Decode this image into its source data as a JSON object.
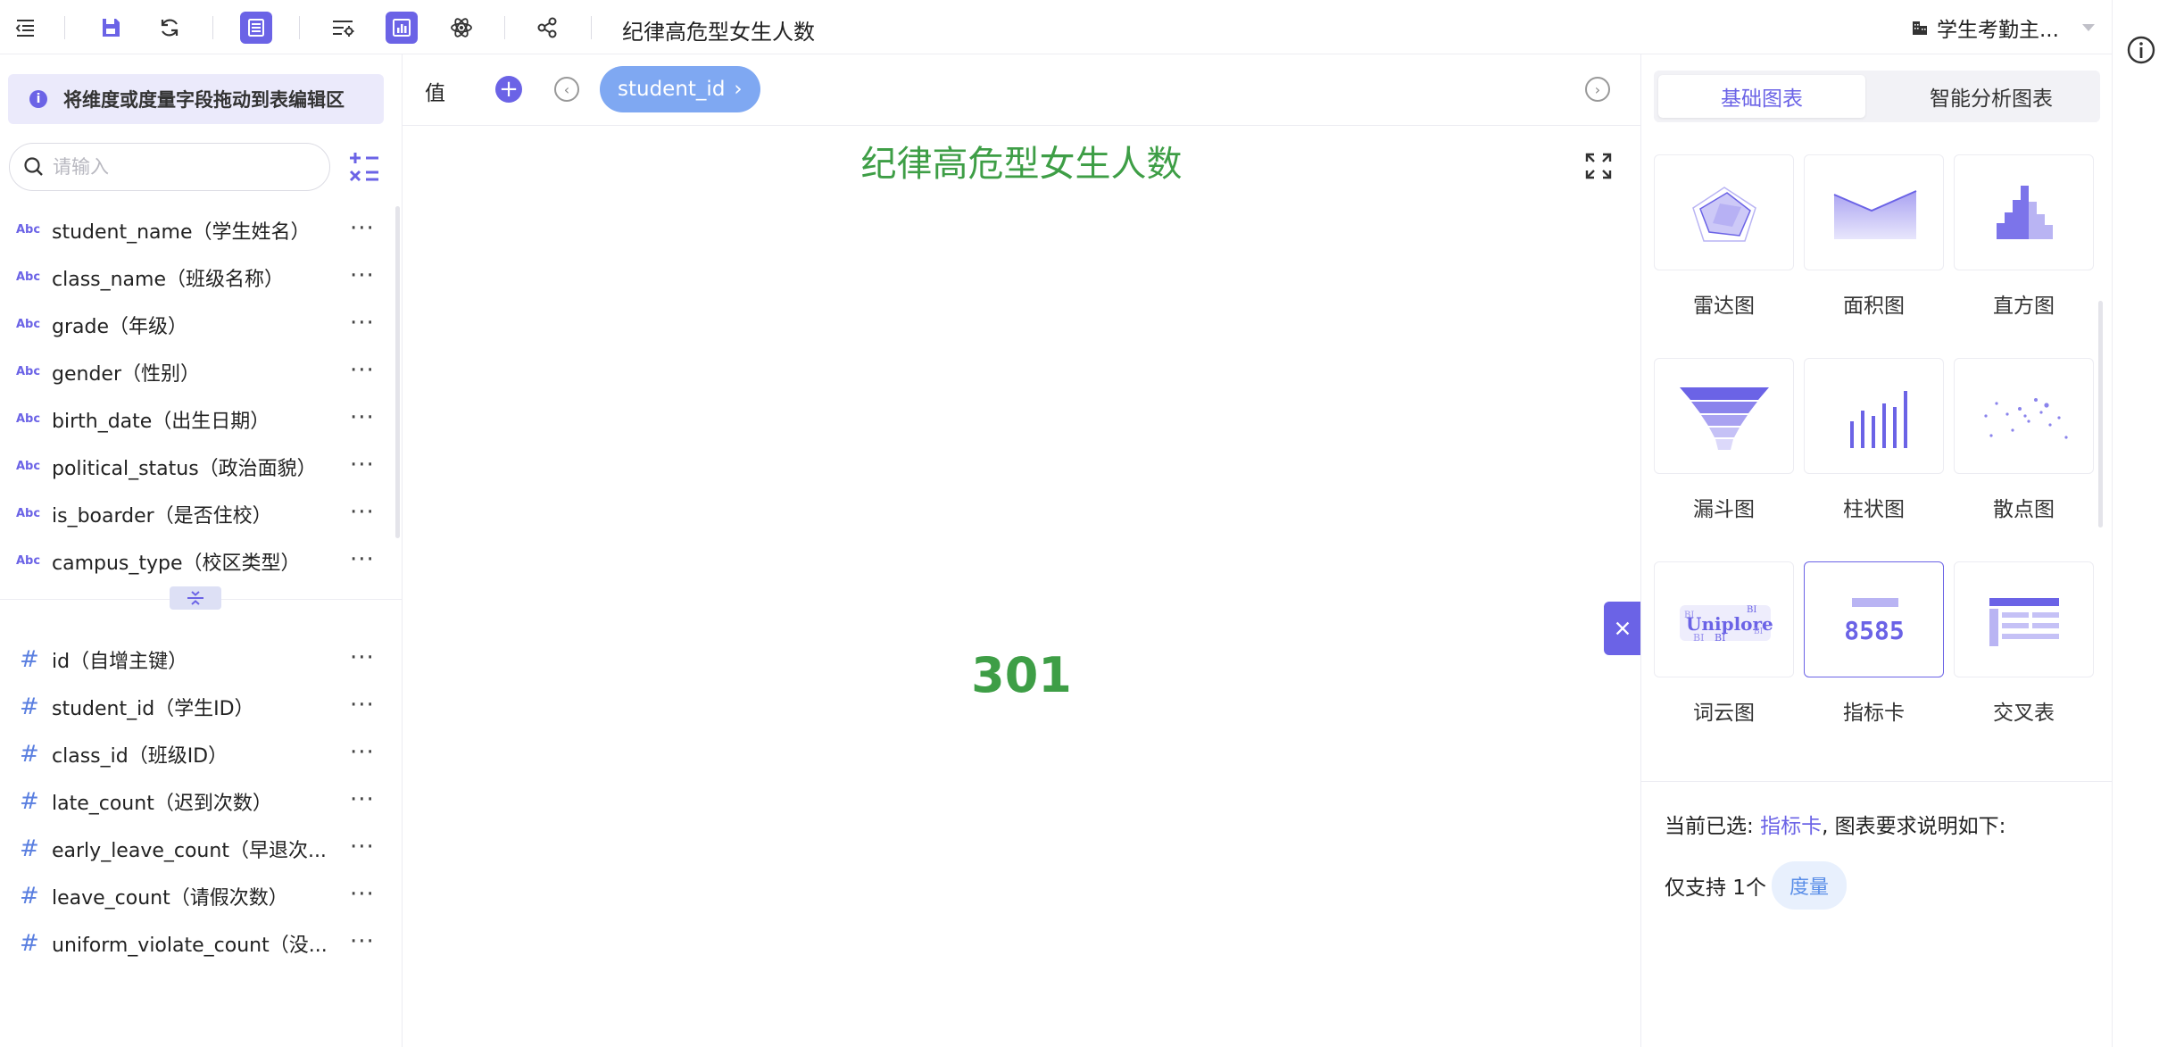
{
  "toolbar": {
    "title": "纪律高危型女生人数",
    "datasource": "学生考勤主..."
  },
  "left_panel": {
    "hint": "将维度或度量字段拖动到表编辑区",
    "search_placeholder": "请输入",
    "dimensions": [
      {
        "type": "Abc",
        "name": "student_name（学生姓名）"
      },
      {
        "type": "Abc",
        "name": "class_name（班级名称）"
      },
      {
        "type": "Abc",
        "name": "grade（年级）"
      },
      {
        "type": "Abc",
        "name": "gender（性别）"
      },
      {
        "type": "Abc",
        "name": "birth_date（出生日期）"
      },
      {
        "type": "Abc",
        "name": "political_status（政治面貌）"
      },
      {
        "type": "Abc",
        "name": "is_boarder（是否住校）"
      },
      {
        "type": "Abc",
        "name": "campus_type（校区类型）"
      }
    ],
    "measures": [
      {
        "type": "#",
        "name": "id（自增主键）"
      },
      {
        "type": "#",
        "name": "student_id（学生ID）"
      },
      {
        "type": "#",
        "name": "class_id（班级ID）"
      },
      {
        "type": "#",
        "name": "late_count（迟到次数）"
      },
      {
        "type": "#",
        "name": "early_leave_count（早退次..."
      },
      {
        "type": "#",
        "name": "leave_count（请假次数）"
      },
      {
        "type": "#",
        "name": "uniform_violate_count（没..."
      }
    ],
    "more": "···"
  },
  "center": {
    "shelf_label": "值",
    "chip_label": "student_id",
    "chip_arrow": "›",
    "chart_title": "纪律高危型女生人数",
    "kpi_value": "301"
  },
  "right_panel": {
    "tabs": [
      "基础图表",
      "智能分析图表"
    ],
    "chart_types": [
      {
        "label": "雷达图",
        "icon": "radar-chart-icon"
      },
      {
        "label": "面积图",
        "icon": "area-chart-icon"
      },
      {
        "label": "直方图",
        "icon": "histogram-icon"
      },
      {
        "label": "漏斗图",
        "icon": "funnel-chart-icon"
      },
      {
        "label": "柱状图",
        "icon": "bar-chart-icon"
      },
      {
        "label": "散点图",
        "icon": "scatter-chart-icon"
      },
      {
        "label": "词云图",
        "icon": "word-cloud-icon"
      },
      {
        "label": "指标卡",
        "icon": "kpi-card-icon",
        "selected": true
      },
      {
        "label": "交叉表",
        "icon": "pivot-table-icon"
      }
    ],
    "kpi_icon_text": "8585",
    "wordcloud_text": "Uniplore",
    "wordcloud_small": "BI",
    "requirement": {
      "prefix": "当前已选: ",
      "selected": "指标卡",
      "suffix": ", 图表要求说明如下:",
      "support_prefix": "仅支持 1个",
      "measure_tag": "度量"
    }
  },
  "colors": {
    "accent": "#6b63e6",
    "kpi_green": "#3e9e46",
    "chip_blue": "#7fa8f2"
  }
}
